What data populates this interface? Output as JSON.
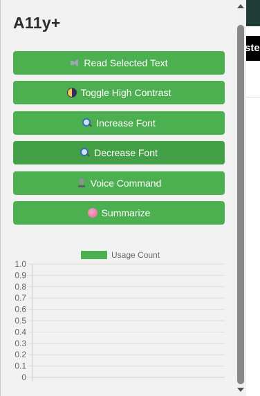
{
  "app": {
    "title": "A11y+"
  },
  "background_page": {
    "label_fragment": "ster"
  },
  "actions": [
    {
      "label": "Read Selected Text",
      "icon": "speaker-icon"
    },
    {
      "label": "Toggle High Contrast",
      "icon": "contrast-icon"
    },
    {
      "label": "Increase Font",
      "icon": "magnify-icon"
    },
    {
      "label": "Decrease Font",
      "icon": "magnify-icon"
    },
    {
      "label": "Voice Command",
      "icon": "microphone-icon"
    },
    {
      "label": "Summarize",
      "icon": "brain-icon"
    }
  ],
  "colors": {
    "button": "#4caf50",
    "button_active": "#43a047",
    "legend_swatch": "#4caf50"
  },
  "chart_data": {
    "type": "bar",
    "series": [
      {
        "name": "Usage Count",
        "values": []
      }
    ],
    "categories": [],
    "ylim": [
      0,
      1
    ],
    "yticks": [
      "1.0",
      "0.9",
      "0.8",
      "0.7",
      "0.6",
      "0.5",
      "0.4",
      "0.3",
      "0.2",
      "0.1",
      "0"
    ],
    "grid": true,
    "legend": "top"
  }
}
